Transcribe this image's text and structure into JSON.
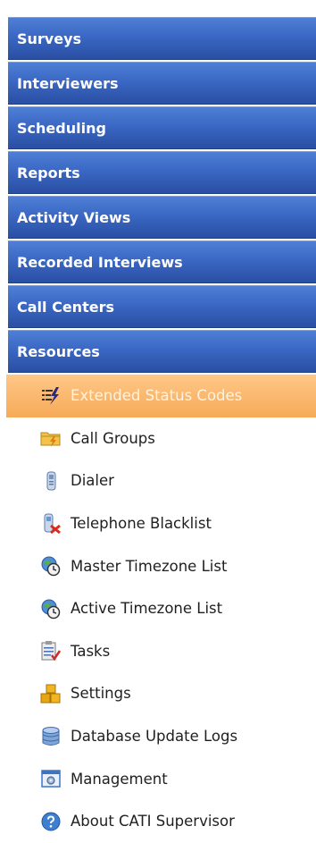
{
  "sections": [
    {
      "label": "Surveys"
    },
    {
      "label": "Interviewers"
    },
    {
      "label": "Scheduling"
    },
    {
      "label": "Reports"
    },
    {
      "label": "Activity Views"
    },
    {
      "label": "Recorded Interviews"
    },
    {
      "label": "Call Centers"
    },
    {
      "label": "Resources"
    }
  ],
  "resources": {
    "items": [
      {
        "label": "Extended Status Codes",
        "icon": "status-codes-icon",
        "active": true
      },
      {
        "label": "Call Groups",
        "icon": "folder-lightning-icon"
      },
      {
        "label": "Dialer",
        "icon": "phone-icon"
      },
      {
        "label": "Telephone Blacklist",
        "icon": "phone-blocked-icon"
      },
      {
        "label": "Master Timezone List",
        "icon": "globe-clock-icon"
      },
      {
        "label": "Active Timezone List",
        "icon": "globe-clock-icon"
      },
      {
        "label": "Tasks",
        "icon": "clipboard-check-icon"
      },
      {
        "label": "Settings",
        "icon": "boxes-icon"
      },
      {
        "label": "Database Update Logs",
        "icon": "database-icon"
      },
      {
        "label": "Management",
        "icon": "window-gear-icon"
      },
      {
        "label": "About CATI Supervisor",
        "icon": "help-icon"
      }
    ]
  },
  "colors": {
    "section_top": "#4f7fd6",
    "section_bottom": "#2a4fa3",
    "active_top": "#ffc788",
    "active_bottom": "#f6aa58",
    "active_text": "#fff3df"
  }
}
